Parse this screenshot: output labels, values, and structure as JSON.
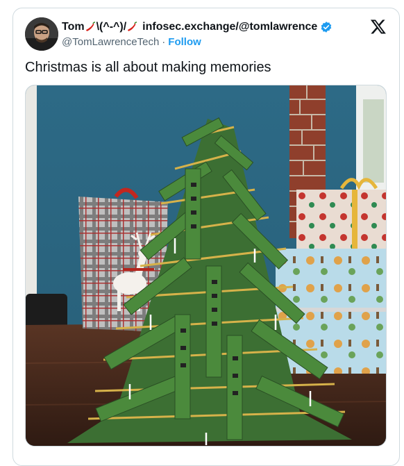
{
  "tweet": {
    "display_name_prefix": "Tom",
    "display_name_middle": "\\(^-^)/",
    "display_name_suffix": "infosec.exchange/@tomlawrence",
    "handle": "@TomLawrenceTech",
    "separator": "·",
    "follow_label": "Follow",
    "text": "Christmas is all about making memories",
    "verified": true,
    "icons": [
      "avatar",
      "chili-pepper-icon",
      "verified-badge-icon",
      "x-logo-icon"
    ],
    "colors": {
      "follow": "#1d9bf0",
      "handle": "#536471",
      "text": "#0f1419",
      "border": "#cfd9de"
    }
  }
}
